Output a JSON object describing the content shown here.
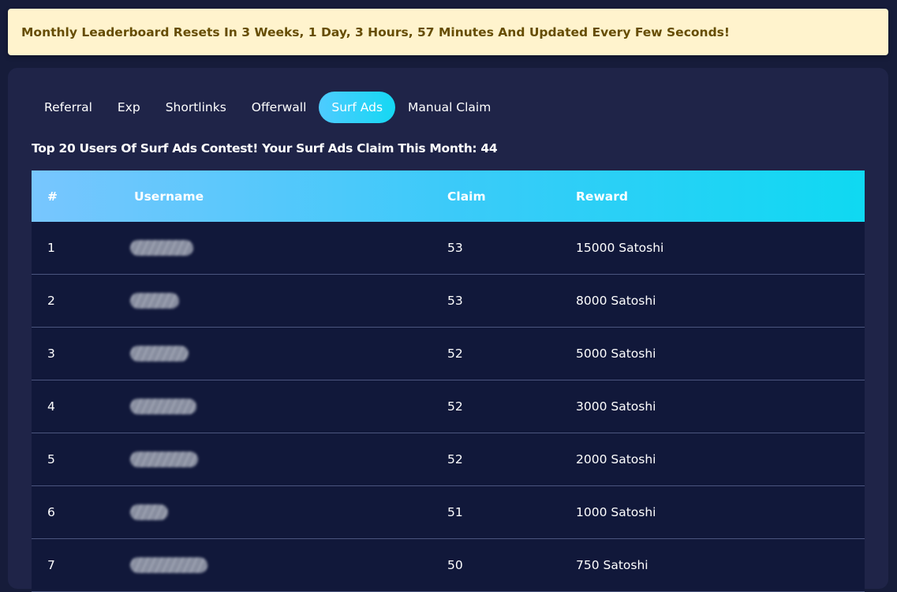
{
  "alert": {
    "text": "Monthly Leaderboard Resets In 3 Weeks, 1 Day, 3 Hours, 57 Minutes And Updated Every Few Seconds!"
  },
  "tabs": [
    {
      "label": "Referral",
      "active": false
    },
    {
      "label": "Exp",
      "active": false
    },
    {
      "label": "Shortlinks",
      "active": false
    },
    {
      "label": "Offerwall",
      "active": false
    },
    {
      "label": "Surf Ads",
      "active": true
    },
    {
      "label": "Manual Claim",
      "active": false
    }
  ],
  "subtitle": "Top 20 Users Of Surf Ads Contest! Your Surf Ads Claim This Month: 44",
  "table": {
    "headers": [
      "#",
      "Username",
      "Claim",
      "Reward"
    ],
    "rows": [
      {
        "rank": "1",
        "claim": "53",
        "reward": "15000 Satoshi"
      },
      {
        "rank": "2",
        "claim": "53",
        "reward": "8000 Satoshi"
      },
      {
        "rank": "3",
        "claim": "52",
        "reward": "5000 Satoshi"
      },
      {
        "rank": "4",
        "claim": "52",
        "reward": "3000 Satoshi"
      },
      {
        "rank": "5",
        "claim": "52",
        "reward": "2000 Satoshi"
      },
      {
        "rank": "6",
        "claim": "51",
        "reward": "1000 Satoshi"
      },
      {
        "rank": "7",
        "claim": "50",
        "reward": "750 Satoshi"
      }
    ]
  },
  "colors": {
    "background": "#161c3a",
    "card": "#1f2448",
    "row": "#11183a",
    "alert_bg": "#fff3cd",
    "alert_text": "#664d03",
    "accent": "#15d8f3"
  }
}
